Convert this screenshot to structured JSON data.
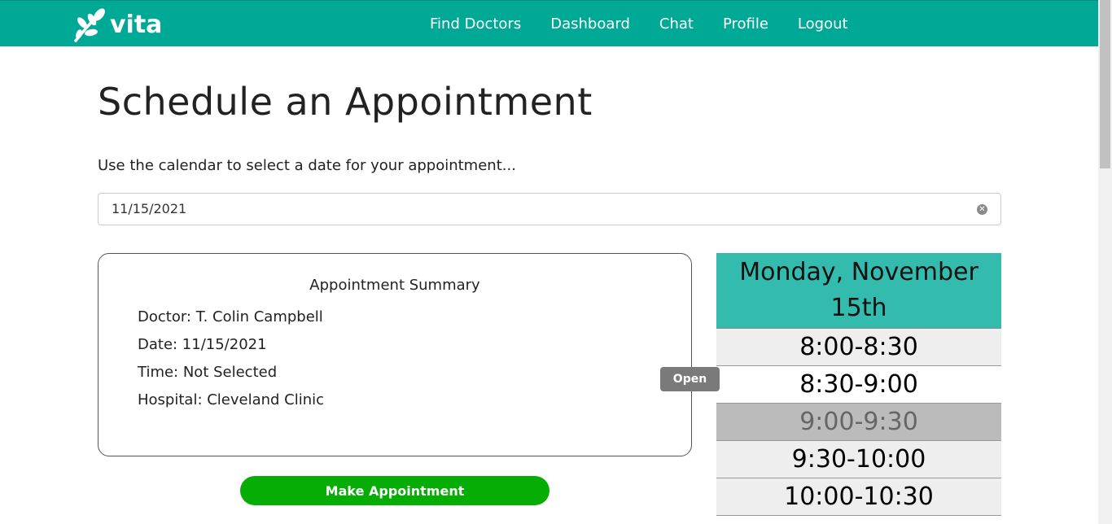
{
  "brand": {
    "name": "vita",
    "logo_icon": "leaf-branch-icon",
    "color": "#00a896"
  },
  "nav": {
    "items": [
      {
        "label": "Find Doctors"
      },
      {
        "label": "Dashboard"
      },
      {
        "label": "Chat"
      },
      {
        "label": "Profile"
      },
      {
        "label": "Logout"
      }
    ]
  },
  "page": {
    "title": "Schedule an Appointment",
    "instructions": "Use the calendar to select a date for your appointment..."
  },
  "date_input": {
    "value": "11/15/2021",
    "clear_icon": "clear-circle-icon"
  },
  "summary": {
    "title": "Appointment Summary",
    "doctor": "Doctor: T. Colin Campbell",
    "date": "Date: 11/15/2021",
    "time": "Time: Not Selected",
    "hospital": "Hospital: Cleveland Clinic"
  },
  "actions": {
    "make_appointment": "Make Appointment",
    "button_color": "#05ad05"
  },
  "tooltip": {
    "label": "Open"
  },
  "schedule": {
    "header": "Monday, November 15th",
    "header_color": "#33bbad",
    "slots": [
      {
        "label": "8:00-8:30",
        "status": "available"
      },
      {
        "label": "8:30-9:00",
        "status": "available"
      },
      {
        "label": "9:00-9:30",
        "status": "unavailable"
      },
      {
        "label": "9:30-10:00",
        "status": "available"
      },
      {
        "label": "10:00-10:30",
        "status": "available"
      }
    ]
  }
}
